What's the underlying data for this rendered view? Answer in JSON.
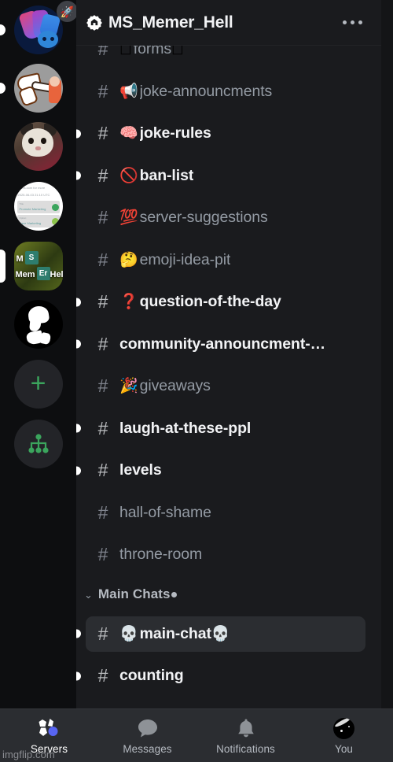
{
  "header": {
    "server_name": "MS_Memer_Hell",
    "badge_icon": "community-verified-badge-icon",
    "overflow_icon": "more-options-icon"
  },
  "server_rail": {
    "items": [
      {
        "name": "discord-clan-server",
        "icon": "server-avatar-discord",
        "unread": true,
        "active": false,
        "boosted": true,
        "badge_icon": "rocket-boost-icon"
      },
      {
        "name": "jojo-meme-server",
        "icon": "server-avatar-jojo",
        "unread": true,
        "active": false,
        "boosted": false
      },
      {
        "name": "cat-meme-server",
        "icon": "server-avatar-cat",
        "unread": false,
        "active": false,
        "boosted": false
      },
      {
        "name": "document-server",
        "icon": "server-avatar-document",
        "unread": false,
        "active": false,
        "boosted": false
      },
      {
        "name": "ms-memer-hell-server",
        "icon": "server-avatar-ms-memer-hell",
        "unread": false,
        "active": true,
        "boosted": false
      },
      {
        "name": "black-white-server",
        "icon": "server-avatar-bw",
        "unread": false,
        "active": false,
        "boosted": false
      }
    ],
    "add_server": {
      "name": "add-server-button",
      "icon": "plus-icon",
      "glyph": "+"
    },
    "explore_servers": {
      "name": "explore-servers-button",
      "icon": "explore-network-icon"
    }
  },
  "avatar_art": {
    "document": {
      "line1": "utters.com for more",
      "line2": "2025-06-03 21:10 UTC",
      "row1_label": "Title",
      "row1_text": "Promote Marketing",
      "row2_label": "Option",
      "row2_text": "Face Marketing"
    },
    "ms_memer": {
      "word1": "M",
      "word2": "Mem",
      "word3": "Hell",
      "el1_sym": "S",
      "el1_num": "16",
      "el1_name": "Sulfur",
      "el2_sym": "Er",
      "el2_num": "68",
      "el2_name": "Erbium"
    }
  },
  "channels": [
    {
      "name": "channel-forms",
      "hash": "#",
      "emoji": "◻",
      "emoji2": "◻",
      "label": "forms",
      "unread": false,
      "selected": false,
      "clipped_top": true
    },
    {
      "name": "channel-joke-announcments",
      "hash": "#",
      "emoji": "📢",
      "label": "joke-announcments",
      "unread": false,
      "selected": false
    },
    {
      "name": "channel-joke-rules",
      "hash": "#",
      "emoji": "🧠",
      "label": "joke-rules",
      "unread": true,
      "selected": false
    },
    {
      "name": "channel-ban-list",
      "hash": "#",
      "emoji": "🚫",
      "label": "ban-list",
      "unread": true,
      "selected": false
    },
    {
      "name": "channel-server-suggestions",
      "hash": "#",
      "emoji": "💯",
      "label": "server-suggestions",
      "unread": false,
      "selected": false
    },
    {
      "name": "channel-emoji-idea-pit",
      "hash": "#",
      "emoji": "🤔",
      "label": "emoji-idea-pit",
      "unread": false,
      "selected": false
    },
    {
      "name": "channel-question-of-the-day",
      "hash": "#",
      "emoji": "❓",
      "label": "question-of-the-day",
      "unread": true,
      "selected": false
    },
    {
      "name": "channel-community-announcment",
      "hash": "#",
      "emoji": "",
      "label": "community-announcment-…",
      "unread": true,
      "selected": false
    },
    {
      "name": "channel-giveaways",
      "hash": "#",
      "emoji": "🎉",
      "label": "giveaways",
      "unread": false,
      "selected": false
    },
    {
      "name": "channel-laugh-at-these-ppl",
      "hash": "#",
      "emoji": "",
      "label": "laugh-at-these-ppl",
      "unread": true,
      "selected": false
    },
    {
      "name": "channel-levels",
      "hash": "#",
      "emoji": "",
      "label": "levels",
      "unread": true,
      "selected": false
    },
    {
      "name": "channel-hall-of-shame",
      "hash": "#",
      "emoji": "",
      "label": "hall-of-shame",
      "unread": false,
      "selected": false
    },
    {
      "name": "channel-throne-room",
      "hash": "#",
      "emoji": "",
      "label": "throne-room",
      "unread": false,
      "selected": false
    }
  ],
  "category": {
    "name": "category-main-chats",
    "label": "Main Chats",
    "chevron": "⌄",
    "has_dot": true
  },
  "channels_after_category": [
    {
      "name": "channel-main-chat",
      "hash": "#",
      "emoji": "💀",
      "emoji2": "💀",
      "label": "main-chat",
      "unread": true,
      "selected": true
    },
    {
      "name": "channel-counting",
      "hash": "#",
      "emoji": "",
      "label": "counting",
      "unread": true,
      "selected": false,
      "clipped_bottom": true
    }
  ],
  "bottom_nav": {
    "items": [
      {
        "name": "nav-servers",
        "label": "Servers",
        "icon": "servers-icon",
        "active": true,
        "badge": true
      },
      {
        "name": "nav-messages",
        "label": "Messages",
        "icon": "messages-bubble-icon",
        "active": false,
        "badge": false
      },
      {
        "name": "nav-notifications",
        "label": "Notifications",
        "icon": "bell-icon",
        "active": false,
        "badge": false
      },
      {
        "name": "nav-you",
        "label": "You",
        "icon": "user-avatar-icon",
        "active": false,
        "badge": false
      }
    ]
  },
  "watermark": {
    "text": "imgflip.com"
  },
  "colors": {
    "rail_bg": "#0d0e10",
    "panel_bg": "#1a1b1e",
    "selected_row_bg": "#2b2d31",
    "nav_bg": "#2b2d31",
    "text_muted": "#949ba4",
    "text_bright": "#f2f3f5",
    "accent_blurple": "#5865f2",
    "accent_green": "#3ba55d"
  }
}
